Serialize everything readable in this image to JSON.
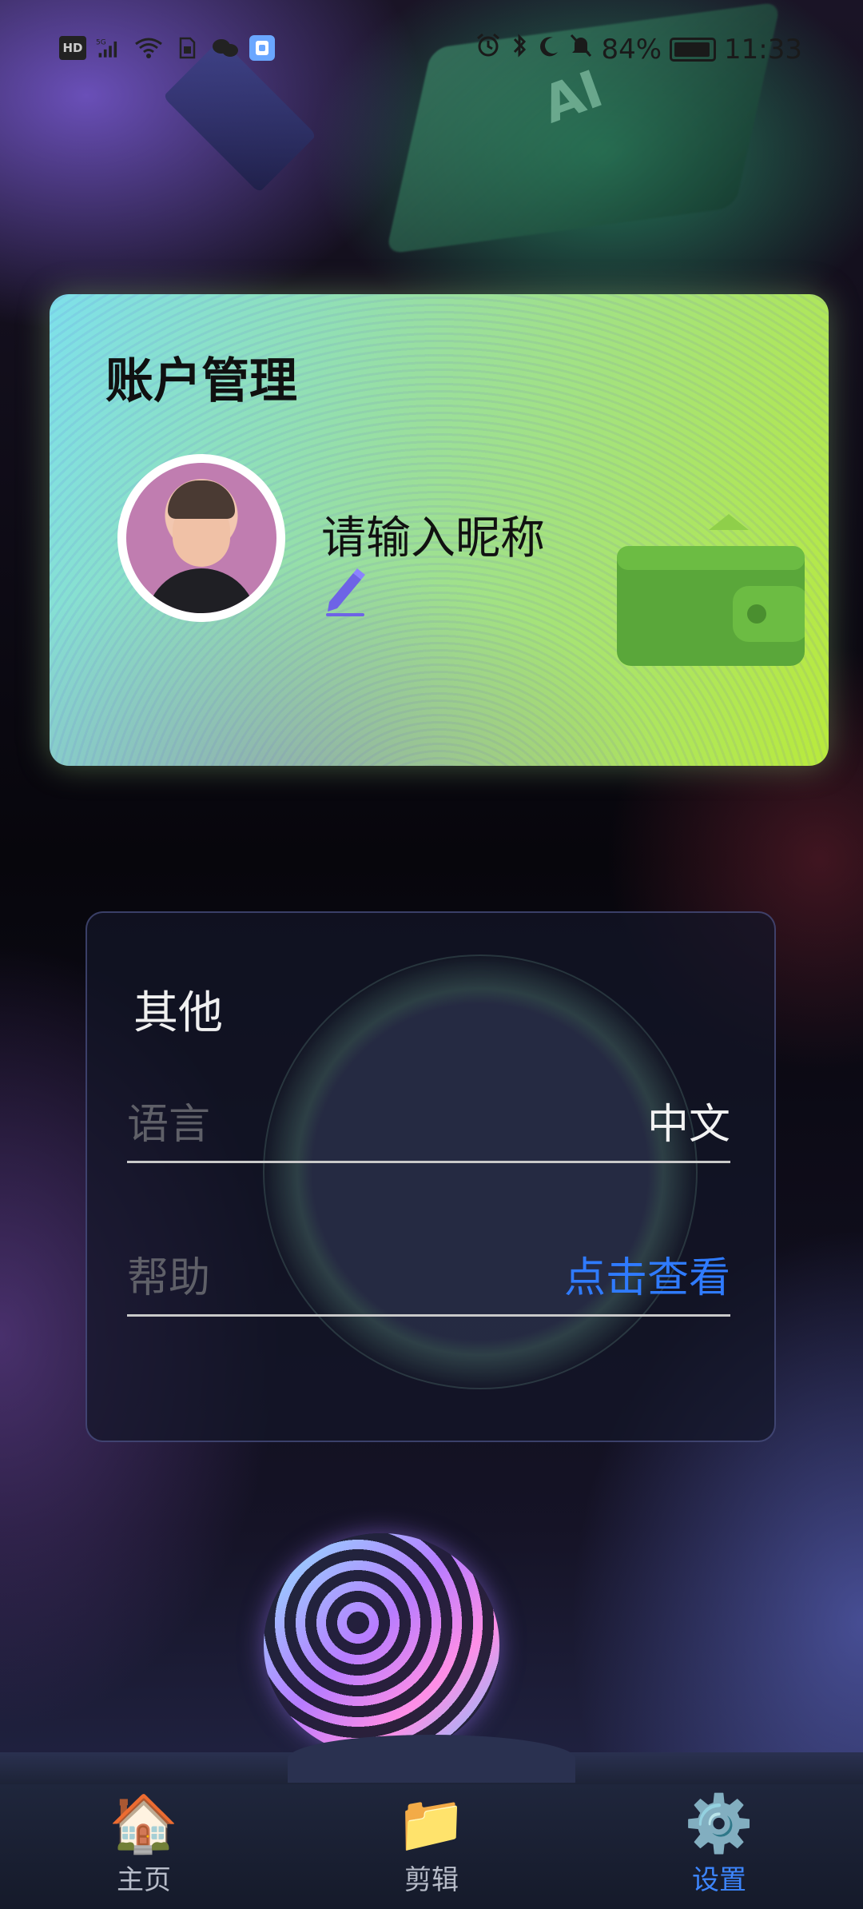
{
  "status_bar": {
    "left_icons": [
      "hd-icon",
      "5g-signal-icon",
      "wifi-icon",
      "sim-icon",
      "wechat-icon",
      "app-notification-icon"
    ],
    "battery_percent": "84%",
    "time": "11:33",
    "battery_level": 0.84
  },
  "background": {
    "chip_text": "AI"
  },
  "account_card": {
    "title": "账户管理",
    "nickname_placeholder": "请输入昵称"
  },
  "other_card": {
    "title": "其他",
    "rows": [
      {
        "label": "语言",
        "value": "中文"
      },
      {
        "label": "帮助",
        "value": "点击查看"
      }
    ]
  },
  "bottom_nav": {
    "items": [
      {
        "label": "主页",
        "icon": "home-icon"
      },
      {
        "label": "剪辑",
        "icon": "folder-icon"
      },
      {
        "label": "设置",
        "icon": "gear-icon"
      }
    ],
    "active_index": 2
  },
  "colors": {
    "accent": "#2f7bff",
    "card_gradient_start": "#7ee0ea",
    "card_gradient_end": "#b9ea3c"
  }
}
